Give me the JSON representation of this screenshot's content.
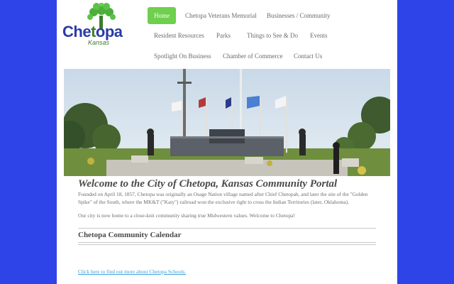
{
  "logo": {
    "name_left": "Che",
    "name_right": "opa",
    "subtitle": "Kansas"
  },
  "nav": {
    "row1": [
      "Home",
      "Chetopa Veterans Memorial",
      "Businesses / Community"
    ],
    "row2": [
      "Resident Resources",
      "Parks",
      "Things to See & Do",
      "Events"
    ],
    "row3": [
      "Spotlight On Business",
      "Chamber of Commerce",
      "Contact Us"
    ],
    "active": "Home"
  },
  "main": {
    "welcome_heading": "Welcome to the City of Chetopa, Kansas Community Portal",
    "intro_paragraph": "Founded on April 18, 1857, Chetopa was originally an Osage Nation village named after Chief Chetopah, and later the site of the \"Golden Spike\" of the South, where the MK&T (\"Katy\") railroad won the exclusive right to cross the Indian Territories (later, Oklahoma).",
    "community_paragraph": "Our city is now home to a close-knit community sharing true Midwestern values. Welcome to Chetopa!",
    "calendar_title": "Chetopa Community Calendar",
    "schools_link": "Click here to find out more about Chetopa Schools."
  },
  "colors": {
    "background": "#2f44e8",
    "nav_active": "#6fcf4e",
    "link": "#3aa0d8",
    "logo_text": "#2a3aa8",
    "logo_green": "#3b7d2b"
  }
}
